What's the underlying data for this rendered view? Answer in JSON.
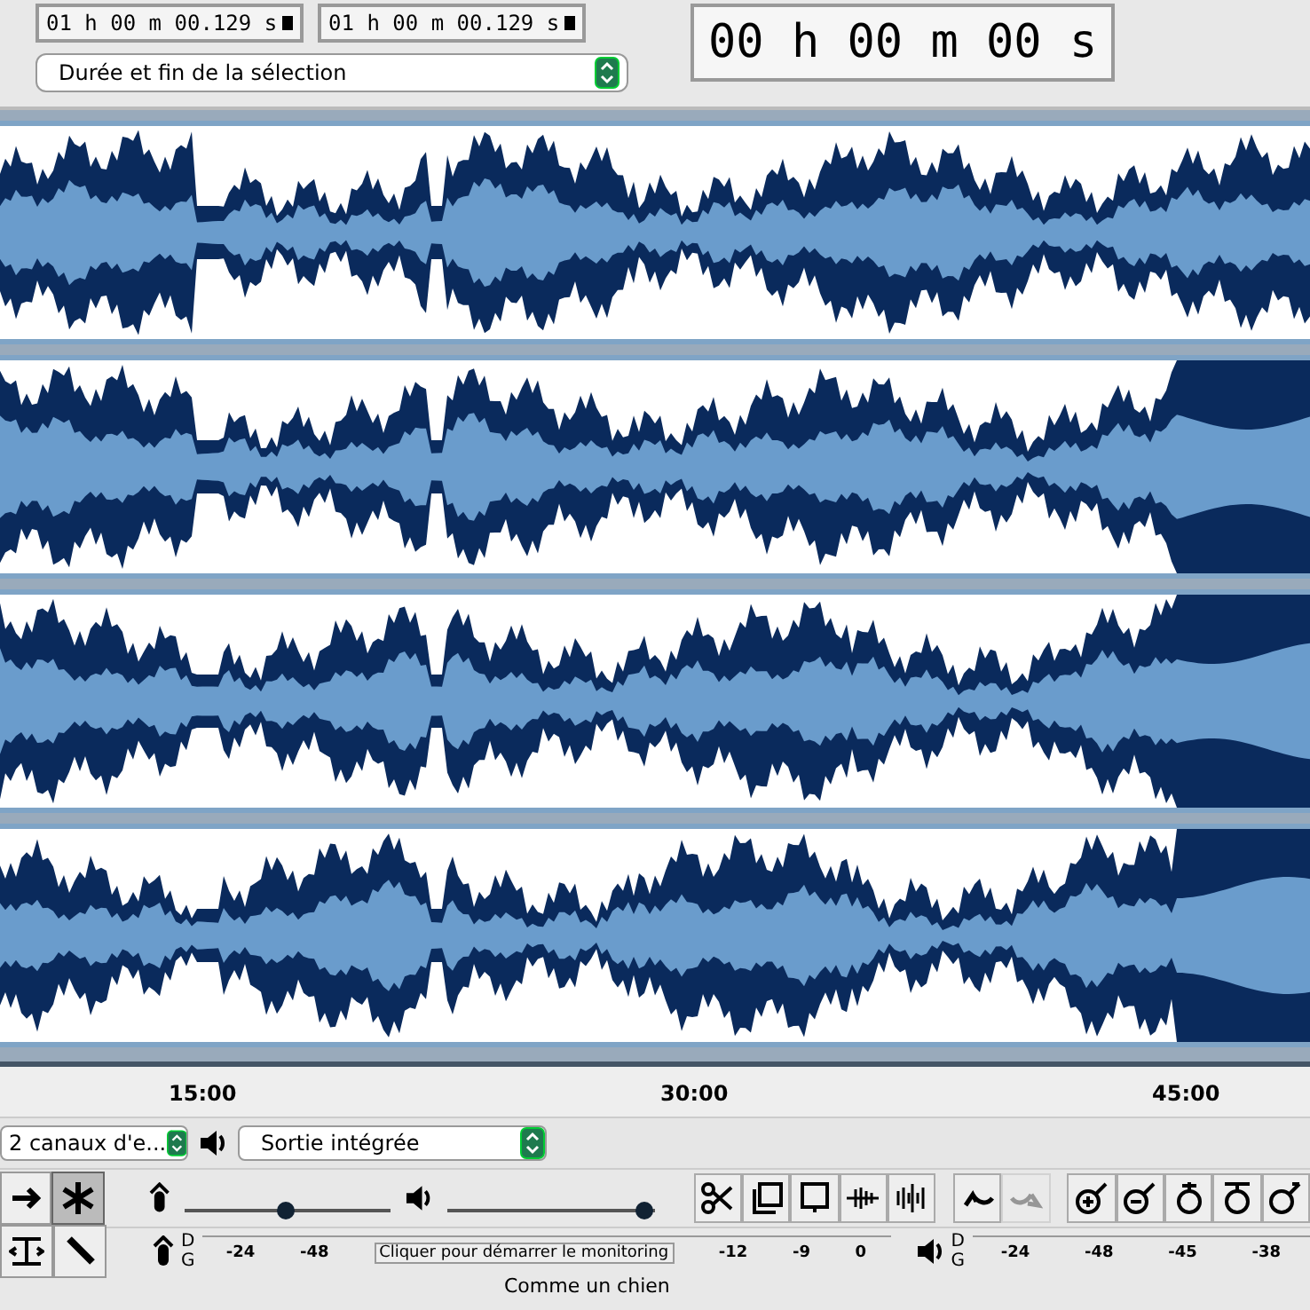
{
  "selection_toolbar": {
    "start": "01 h 00 m 00.129 s",
    "end": "01 h 00 m 00.129 s",
    "format": "Durée et fin de la sélection"
  },
  "time_display": "00 h 00 m 00 s",
  "ruler": {
    "ticks": [
      "15:00",
      "30:00",
      "45:00"
    ]
  },
  "device_toolbar": {
    "input": "2 canaux d'e...",
    "output": "Sortie intégrée"
  },
  "mixer": {
    "input": {
      "level": 0.49
    },
    "output": {
      "level": 0.95
    }
  },
  "tools": [
    {
      "kind": "arrow",
      "selected": false
    },
    {
      "kind": "multi",
      "selected": true
    },
    {
      "kind": "timeshift",
      "selected": false
    },
    {
      "kind": "pencil",
      "selected": false
    }
  ],
  "edit_buttons": [
    {
      "kind": "cut",
      "disabled": false
    },
    {
      "kind": "copy",
      "disabled": false
    },
    {
      "kind": "paste",
      "disabled": false
    },
    {
      "kind": "trim",
      "disabled": false
    },
    {
      "kind": "silence",
      "disabled": false
    },
    {
      "kind": "undo",
      "disabled": false
    },
    {
      "kind": "redo",
      "disabled": true
    },
    {
      "kind": "zoom_in",
      "disabled": false
    },
    {
      "kind": "zoom_out",
      "disabled": false
    },
    {
      "kind": "fit_selection",
      "disabled": false
    },
    {
      "kind": "fit_project",
      "disabled": false
    },
    {
      "kind": "zoom_toggle",
      "disabled": false
    }
  ],
  "record_meter": {
    "channels": [
      "D",
      "G"
    ],
    "ticks": [
      "-24",
      "-48"
    ],
    "prompt": "Cliquer pour démarrer le monitoring",
    "ticks_after": [
      "-12",
      "-9",
      "0"
    ]
  },
  "play_meter": {
    "channels": [
      "D",
      "G"
    ],
    "ticks": [
      "-24",
      "-48",
      "-45",
      "-38"
    ]
  },
  "status_bar": "Comme un chien"
}
